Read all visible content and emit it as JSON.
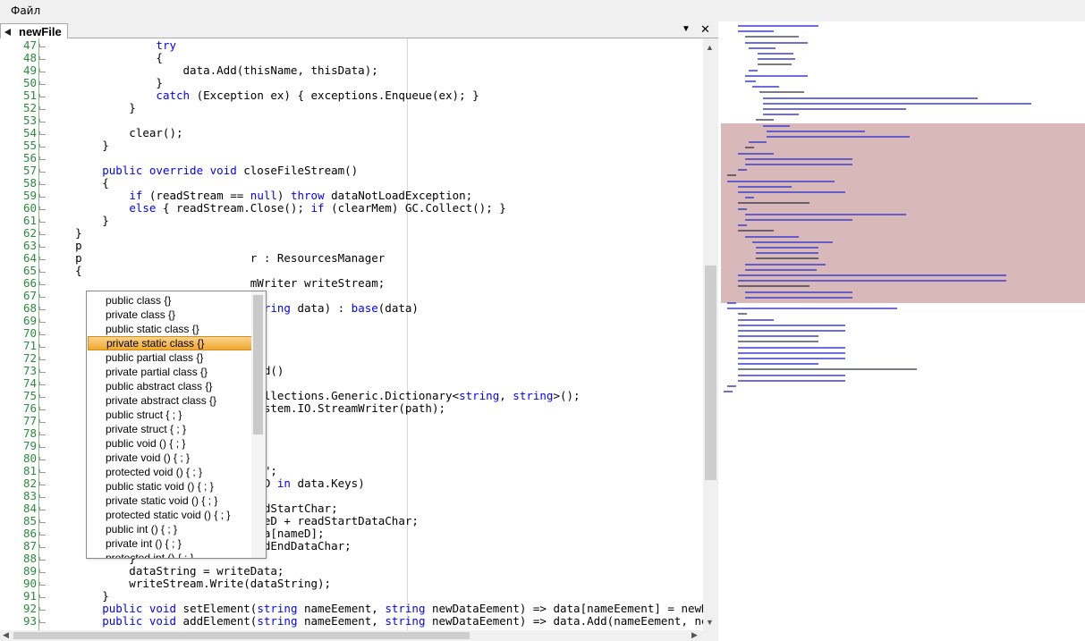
{
  "menu": {
    "file_label": "Файл"
  },
  "tab": {
    "name": "newFile",
    "dropdown_icon": "▼",
    "close_icon": "✕"
  },
  "editor": {
    "lines": [
      {
        "n": "47",
        "code": [
          [
            "plain",
            "                "
          ],
          [
            "kw",
            "try"
          ]
        ]
      },
      {
        "n": "48",
        "code": [
          [
            "plain",
            "                {"
          ]
        ]
      },
      {
        "n": "49",
        "code": [
          [
            "plain",
            "                    data.Add(thisName, thisData);"
          ]
        ]
      },
      {
        "n": "50",
        "code": [
          [
            "plain",
            "                }"
          ]
        ]
      },
      {
        "n": "51",
        "code": [
          [
            "plain",
            "                "
          ],
          [
            "kw",
            "catch"
          ],
          [
            "plain",
            " (Exception ex) { exceptions.Enqueue(ex); }"
          ]
        ]
      },
      {
        "n": "52",
        "code": [
          [
            "plain",
            "            }"
          ]
        ]
      },
      {
        "n": "53",
        "code": [
          [
            "plain",
            ""
          ]
        ]
      },
      {
        "n": "54",
        "code": [
          [
            "plain",
            "            clear();"
          ]
        ]
      },
      {
        "n": "55",
        "code": [
          [
            "plain",
            "        }"
          ]
        ]
      },
      {
        "n": "56",
        "code": [
          [
            "plain",
            ""
          ]
        ]
      },
      {
        "n": "57",
        "code": [
          [
            "plain",
            "        "
          ],
          [
            "kw",
            "public override void"
          ],
          [
            "plain",
            " closeFileStream()"
          ]
        ]
      },
      {
        "n": "58",
        "code": [
          [
            "plain",
            "        {"
          ]
        ]
      },
      {
        "n": "59",
        "code": [
          [
            "plain",
            "            "
          ],
          [
            "kw",
            "if"
          ],
          [
            "plain",
            " (readStream == "
          ],
          [
            "kw",
            "null"
          ],
          [
            "plain",
            ") "
          ],
          [
            "kw",
            "throw"
          ],
          [
            "plain",
            " dataNotLoadException;"
          ]
        ]
      },
      {
        "n": "60",
        "code": [
          [
            "plain",
            "            "
          ],
          [
            "kw",
            "else"
          ],
          [
            "plain",
            " { readStream.Close(); "
          ],
          [
            "kw",
            "if"
          ],
          [
            "plain",
            " (clearMem) GC.Collect(); }"
          ]
        ]
      },
      {
        "n": "61",
        "code": [
          [
            "plain",
            "        }"
          ]
        ]
      },
      {
        "n": "62",
        "code": [
          [
            "plain",
            "    }"
          ]
        ]
      },
      {
        "n": "63",
        "code": [
          [
            "plain",
            "    p"
          ]
        ]
      },
      {
        "n": "64",
        "code": [
          [
            "plain",
            "    p                         r : ResourcesManager"
          ]
        ]
      },
      {
        "n": "65",
        "code": [
          [
            "plain",
            "    {"
          ]
        ]
      },
      {
        "n": "66",
        "code": [
          [
            "plain",
            "                              mWriter writeStream;"
          ]
        ]
      },
      {
        "n": "67",
        "code": [
          [
            "plain",
            ""
          ]
        ]
      },
      {
        "n": "68",
        "code": [
          [
            "plain",
            "                              "
          ],
          [
            "kw",
            "string"
          ],
          [
            "plain",
            " data) : "
          ],
          [
            "kw",
            "base"
          ],
          [
            "plain",
            "(data)"
          ]
        ]
      },
      {
        "n": "69",
        "code": [
          [
            "plain",
            ""
          ]
        ]
      },
      {
        "n": "70",
        "code": [
          [
            "plain",
            ""
          ]
        ]
      },
      {
        "n": "71",
        "code": [
          [
            "plain",
            ""
          ]
        ]
      },
      {
        "n": "72",
        "code": [
          [
            "plain",
            ""
          ]
        ]
      },
      {
        "n": "73",
        "code": [
          [
            "plain",
            "                              oad()"
          ]
        ]
      },
      {
        "n": "74",
        "code": [
          [
            "plain",
            ""
          ]
        ]
      },
      {
        "n": "75",
        "code": [
          [
            "plain",
            "                              Collections.Generic.Dictionary<"
          ],
          [
            "kw",
            "string"
          ],
          [
            "plain",
            ", "
          ],
          [
            "kw",
            "string"
          ],
          [
            "plain",
            ">();"
          ]
        ]
      },
      {
        "n": "76",
        "code": [
          [
            "plain",
            "                              System.IO.StreamWriter(path);"
          ]
        ]
      },
      {
        "n": "77",
        "code": [
          [
            "plain",
            ""
          ]
        ]
      },
      {
        "n": "78",
        "code": [
          [
            "plain",
            ""
          ]
        ]
      },
      {
        "n": "79",
        "code": [
          [
            "plain",
            ""
          ]
        ]
      },
      {
        "n": "80",
        "code": [
          [
            "plain",
            ""
          ]
        ]
      },
      {
        "n": "81",
        "code": [
          [
            "plain",
            "                               \"\";"
          ]
        ]
      },
      {
        "n": "82",
        "code": [
          [
            "plain",
            "                              meD "
          ],
          [
            "kw",
            "in"
          ],
          [
            "plain",
            " data.Keys)"
          ]
        ]
      },
      {
        "n": "83",
        "code": [
          [
            "plain",
            ""
          ]
        ]
      },
      {
        "n": "84",
        "code": [
          [
            "plain",
            "                              eadStartChar;"
          ]
        ]
      },
      {
        "n": "85",
        "code": [
          [
            "plain",
            "                writeData += nameD + readStartDataChar;"
          ]
        ]
      },
      {
        "n": "86",
        "code": [
          [
            "plain",
            "                writeData += data[nameD];"
          ]
        ]
      },
      {
        "n": "87",
        "code": [
          [
            "plain",
            "                writeData += readEndDataChar;"
          ]
        ]
      },
      {
        "n": "88",
        "code": [
          [
            "plain",
            "            }"
          ]
        ]
      },
      {
        "n": "89",
        "code": [
          [
            "plain",
            "            dataString = writeData;"
          ]
        ]
      },
      {
        "n": "90",
        "code": [
          [
            "plain",
            "            writeStream.Write(dataString);"
          ]
        ]
      },
      {
        "n": "91",
        "code": [
          [
            "plain",
            "        }"
          ]
        ]
      },
      {
        "n": "92",
        "code": [
          [
            "plain",
            "        "
          ],
          [
            "kw",
            "public void"
          ],
          [
            "plain",
            " setElement("
          ],
          [
            "kw",
            "string"
          ],
          [
            "plain",
            " nameEement, "
          ],
          [
            "kw",
            "string"
          ],
          [
            "plain",
            " newDataEement) => data[nameEement] = newDat"
          ]
        ]
      },
      {
        "n": "93",
        "code": [
          [
            "plain",
            "        "
          ],
          [
            "kw",
            "public void"
          ],
          [
            "plain",
            " addElement("
          ],
          [
            "kw",
            "string"
          ],
          [
            "plain",
            " nameEement, "
          ],
          [
            "kw",
            "string"
          ],
          [
            "plain",
            " newDataEement) => data.Add(nameEement, newD"
          ]
        ]
      }
    ]
  },
  "autocomplete": {
    "items": [
      "public class {}",
      "private class {}",
      "public static class {}",
      "private static class {}",
      "public partial class {}",
      "private partial class {}",
      "public abstract class {}",
      "private abstract class {}",
      "public struct { ; }",
      "private struct { ; }",
      "public void () { ; }",
      "private void () { ; }",
      "protected void () { ; }",
      "public static void () { ; }",
      "private static void () { ; }",
      "protected static void () { ; }",
      "public int () { ; }",
      "private int () { ; }",
      "protected int () { ; }"
    ],
    "selected_index": 3
  },
  "colors": {
    "keyword": "#0000ff",
    "line_number": "#2b8a3e",
    "selection": "#f0a830",
    "minimap_viewport": "#d8b8b8"
  }
}
